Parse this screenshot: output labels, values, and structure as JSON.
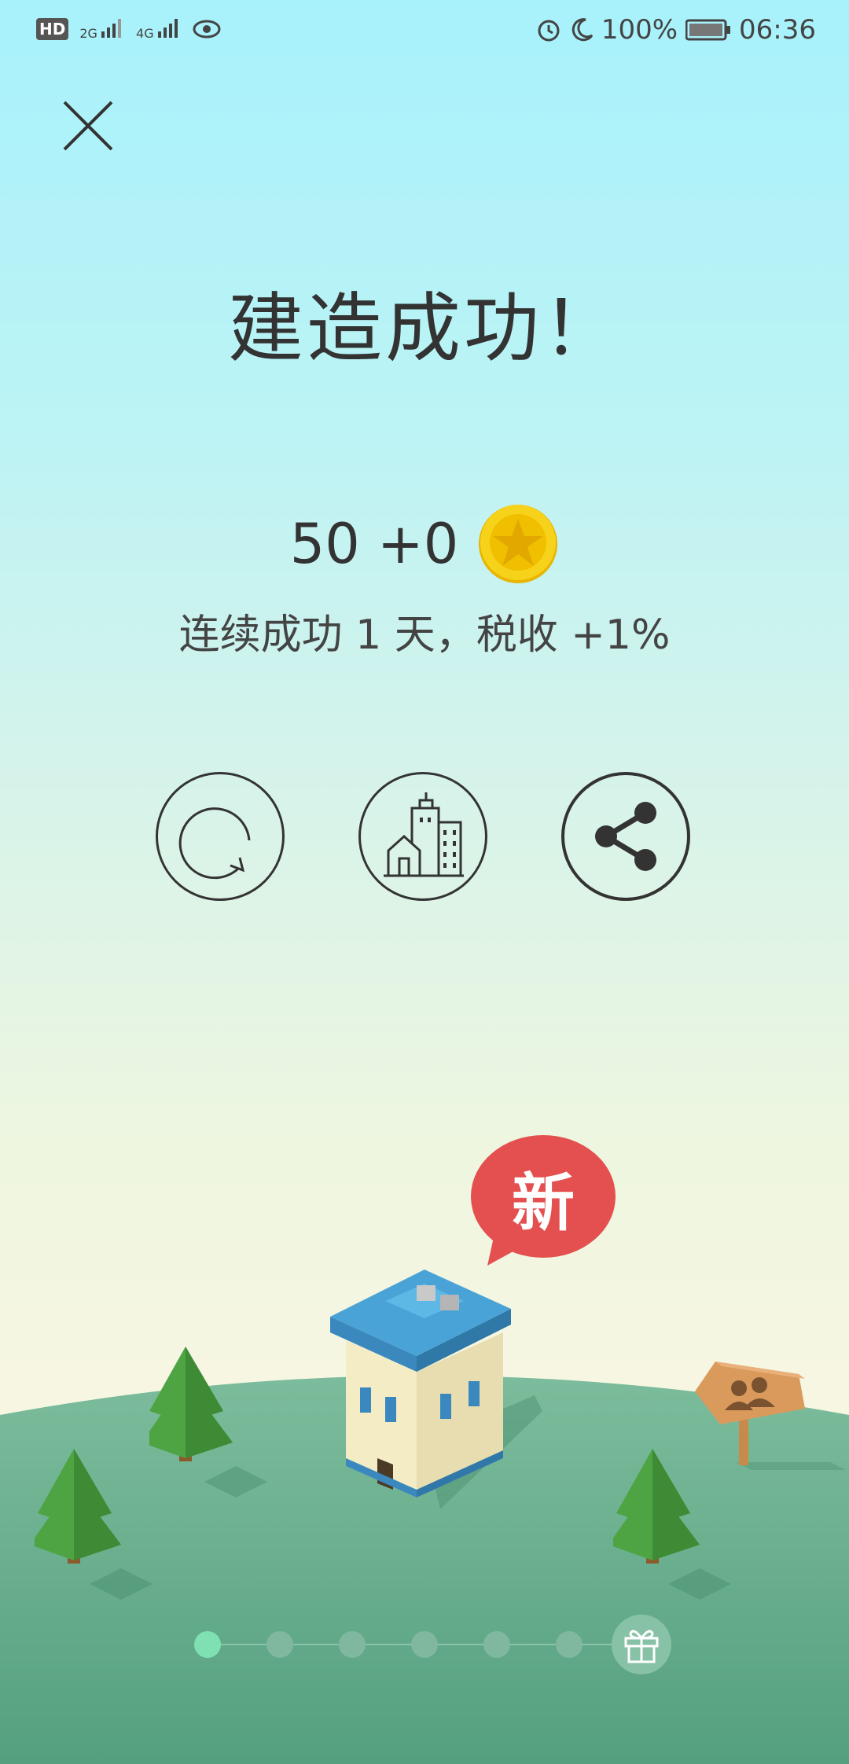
{
  "status_bar": {
    "left_labels": [
      "HD",
      "2G",
      "4G"
    ],
    "battery": "100%",
    "time": "06:36"
  },
  "main": {
    "title": "建造成功！",
    "coins_text": "50 +0",
    "streak_text": "连续成功 1 天，税收 +1%",
    "badge": "新"
  },
  "icons": {
    "close": "close-icon",
    "retry": "retry-icon",
    "city": "city-icon",
    "share": "share-icon",
    "coin": "coin-icon",
    "gift": "gift-icon",
    "signpost": "friends-signpost-icon"
  },
  "pager": {
    "total_dots": 6,
    "active_index": 0
  },
  "colors": {
    "accent_red": "#e45050",
    "ground_green": "#5fa583",
    "tree_green": "#4a9e44",
    "active_dot": "#7fe0b4"
  }
}
